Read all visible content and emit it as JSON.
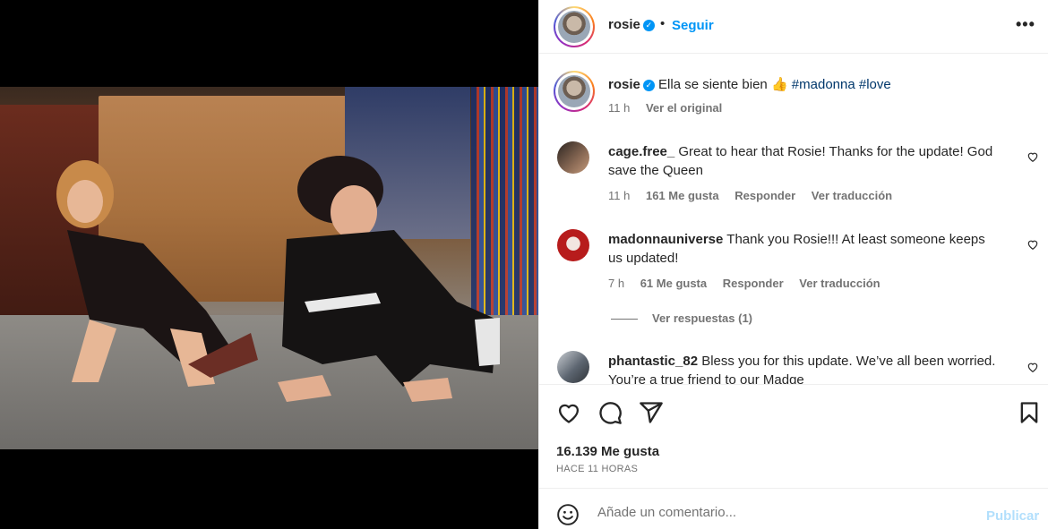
{
  "post": {
    "author": "rosie",
    "follow_label": "Seguir",
    "more_label": "•••",
    "caption_text": "Ella se siente bien 👍",
    "caption_hashtags": "#madonna #love",
    "caption_time": "11 h",
    "see_original": "Ver el original"
  },
  "comments": [
    {
      "user": "cage.free_",
      "text": "Great to hear that Rosie! Thanks for the update! God save the Queen",
      "time": "11 h",
      "likes": "161 Me gusta",
      "reply": "Responder",
      "translate": "Ver traducción"
    },
    {
      "user": "madonnauniverse",
      "text": "Thank you Rosie!!! At least someone keeps us updated!",
      "time": "7 h",
      "likes": "61 Me gusta",
      "reply": "Responder",
      "translate": "Ver traducción",
      "replies": "Ver respuestas (1)"
    },
    {
      "user": "phantastic_82",
      "text": "Bless you for this update. We’ve all been worried. You’re a true friend to our Madge"
    }
  ],
  "stats": {
    "likes": "16.139 Me gusta",
    "time": "HACE 11 HORAS"
  },
  "composer": {
    "placeholder": "Añade un comentario...",
    "publish": "Publicar"
  },
  "icons": [
    "heart-icon",
    "comment-icon",
    "share-icon",
    "bookmark-icon",
    "emoji-icon",
    "verified-icon"
  ],
  "colors": {
    "accent": "#0095f6",
    "hashtag": "#00376b",
    "muted": "#737373",
    "publish_disabled": "#b2dffc"
  }
}
